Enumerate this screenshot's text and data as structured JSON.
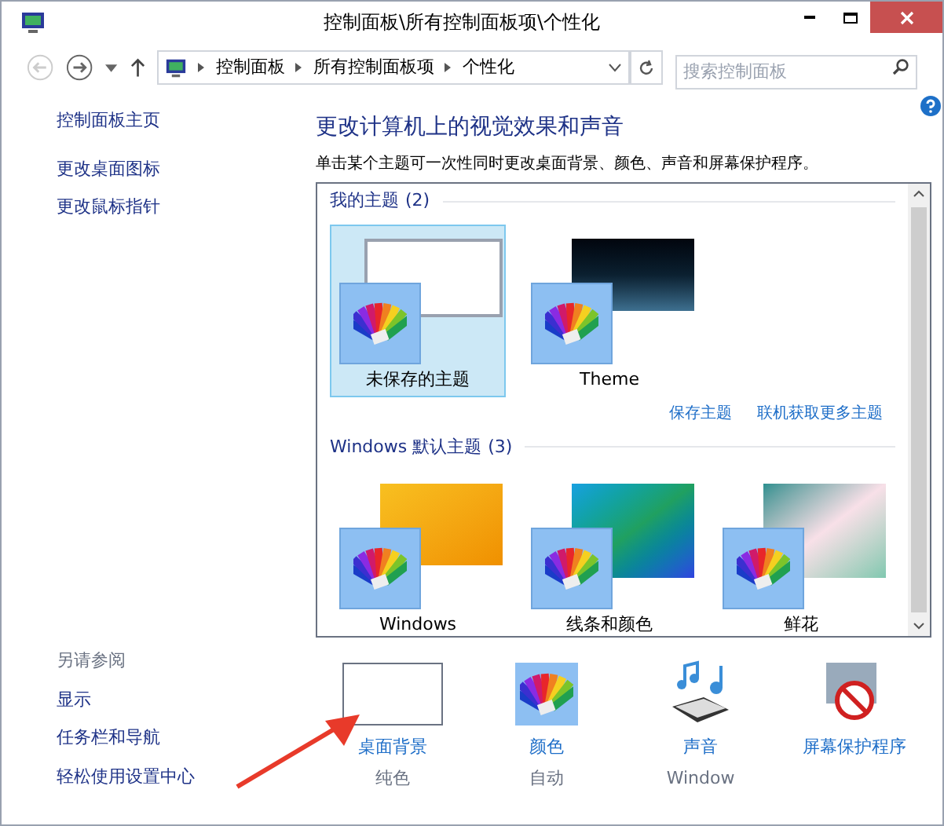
{
  "window": {
    "title": "控制面板\\所有控制面板项\\个性化"
  },
  "address_bar": {
    "crumbs": [
      "控制面板",
      "所有控制面板项",
      "个性化"
    ]
  },
  "search": {
    "placeholder": "搜索控制面板"
  },
  "sidebar": {
    "items": [
      "控制面板主页",
      "更改桌面图标",
      "更改鼠标指针"
    ],
    "see_also": {
      "heading": "另请参阅",
      "items": [
        "显示",
        "任务栏和导航",
        "轻松使用设置中心"
      ]
    }
  },
  "heading": "更改计算机上的视觉效果和声音",
  "description": "单击某个主题可一次性同时更改桌面背景、颜色、声音和屏幕保护程序。",
  "theme_groups": [
    {
      "title": "我的主题",
      "count": "(2)",
      "themes": [
        {
          "name": "未保存的主题",
          "kind": "blank",
          "selected": true
        },
        {
          "name": "Theme",
          "kind": "space",
          "selected": false
        }
      ],
      "links": [
        "保存主题",
        "联机获取更多主题"
      ]
    },
    {
      "title": "Windows 默认主题",
      "count": "(3)",
      "themes": [
        {
          "name": "Windows",
          "kind": "orange",
          "selected": false
        },
        {
          "name": "线条和颜色",
          "kind": "lines",
          "selected": false
        },
        {
          "name": "鲜花",
          "kind": "flowers",
          "selected": false
        }
      ]
    }
  ],
  "settings": [
    {
      "kind": "background",
      "label": "桌面背景",
      "value": "纯色"
    },
    {
      "kind": "color",
      "label": "颜色",
      "value": "自动"
    },
    {
      "kind": "sound",
      "label": "声音",
      "value": "Window"
    },
    {
      "kind": "screensaver",
      "label": "屏幕保护程序"
    }
  ]
}
